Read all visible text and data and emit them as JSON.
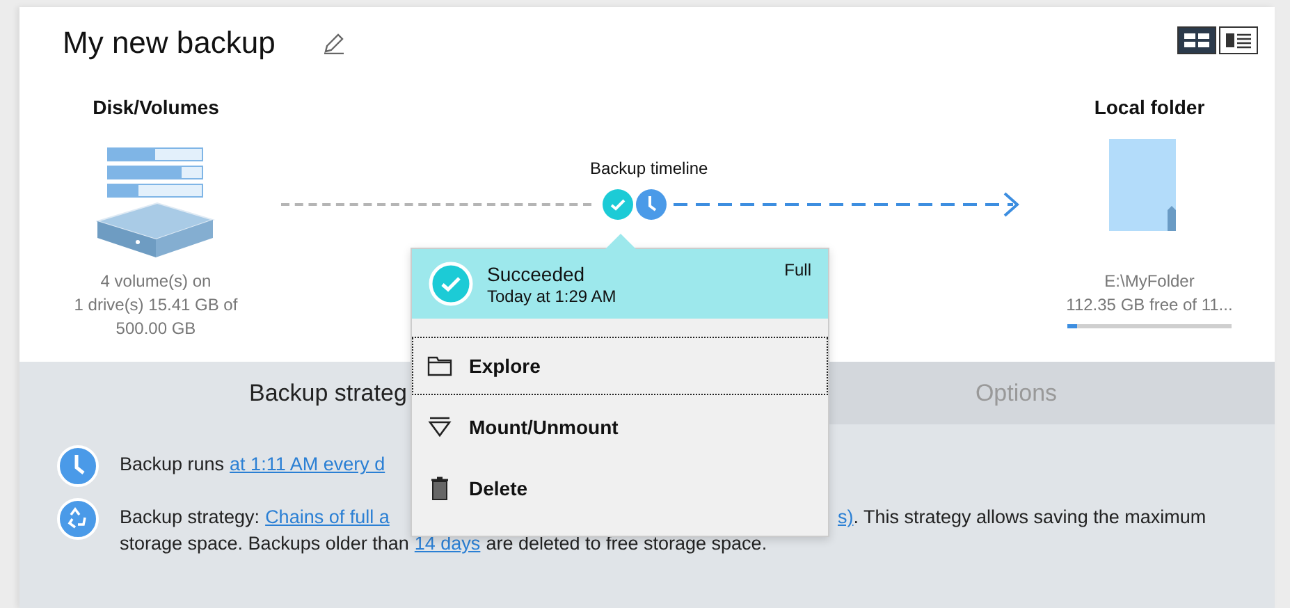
{
  "title": "My new backup",
  "view_toggle": [
    {
      "selected": true
    },
    {
      "selected": false
    }
  ],
  "source": {
    "heading": "Disk/Volumes",
    "details": [
      "4 volume(s) on",
      "1 drive(s) 15.41 GB of",
      "500.00 GB"
    ]
  },
  "timeline": {
    "label": "Backup timeline"
  },
  "destination": {
    "heading": "Local folder",
    "path": "E:\\MyFolder",
    "free": "112.35 GB free of 11...",
    "level": 0.06
  },
  "popup": {
    "status": "Succeeded",
    "time": "Today at 1:29 AM",
    "type": "Full",
    "items": [
      {
        "label": "Explore",
        "kind": "explore",
        "focused": true
      },
      {
        "label": "Mount/Unmount",
        "kind": "mount",
        "focused": false
      },
      {
        "label": "Delete",
        "kind": "delete",
        "focused": false
      }
    ]
  },
  "tabs": [
    {
      "label": "Backup strateg",
      "selected": true
    },
    {
      "label": "Options",
      "selected": false
    }
  ],
  "schedule": {
    "text": "Backup runs",
    "link": "at 1:11 AM every d"
  },
  "strategy": {
    "prefix": "Backup strategy:",
    "link_start": "Chains of full a",
    "link_end": "s)",
    "rest": ". This strategy allows saving the maximum",
    "line2_prefix": "storage space. Backups older than",
    "line2_link": "14 days",
    "line2_rest": "are deleted to free storage space."
  }
}
